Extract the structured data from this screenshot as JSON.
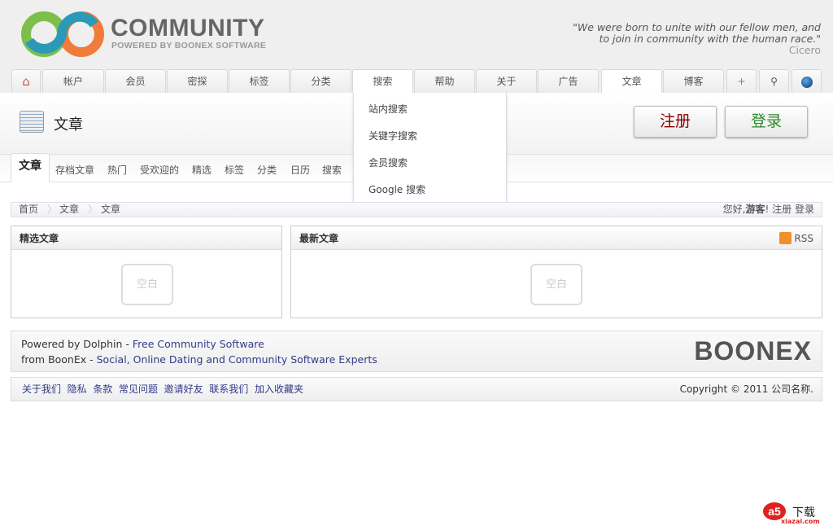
{
  "header": {
    "logo_title": "COMMUNITY",
    "logo_subtitle": "POWERED BY BOONEX SOFTWARE",
    "quote_line1": "\"We were born to unite with our fellow men, and",
    "quote_line2": "to join in community with the human race.\"",
    "quote_author": "Cicero"
  },
  "nav": {
    "tabs": [
      "帐户",
      "会员",
      "密探",
      "标签",
      "分类",
      "搜索",
      "帮助",
      "关于",
      "广告",
      "文章",
      "博客"
    ],
    "active": "文章"
  },
  "dropdown": {
    "items": [
      "站内搜索",
      "关键字搜索",
      "会员搜索",
      "Google 搜索"
    ]
  },
  "page": {
    "title": "文章",
    "register_label": "注册",
    "login_label": "登录"
  },
  "subnav": {
    "active": "文章",
    "items": [
      "存档文章",
      "热门",
      "受欢迎的",
      "精选",
      "标签",
      "分类",
      "日历",
      "搜索"
    ]
  },
  "breadcrumb": {
    "items": [
      "首页",
      "文章",
      "文章"
    ],
    "greeting": "您好,",
    "guest": "游客",
    "excl": "!",
    "register": "注册",
    "login": "登录"
  },
  "boxes": {
    "featured_title": "精选文章",
    "latest_title": "最新文章",
    "rss": "RSS",
    "empty": "空白"
  },
  "footer": {
    "powered": "Powered by Dolphin - ",
    "powered_link": "Free Community Software",
    "from": "from BoonEx - ",
    "from_link": "Social, Online Dating and Community Software Experts",
    "brand": "BOONEX",
    "links": [
      "关于我们",
      "隐私",
      "条款",
      "常见问题",
      "邀请好友",
      "联系我们",
      "加入收藏夹"
    ],
    "copyright": "Copyright © 2011 公司名称."
  },
  "watermark": {
    "text": "下载",
    "site": "xiazai.com"
  }
}
